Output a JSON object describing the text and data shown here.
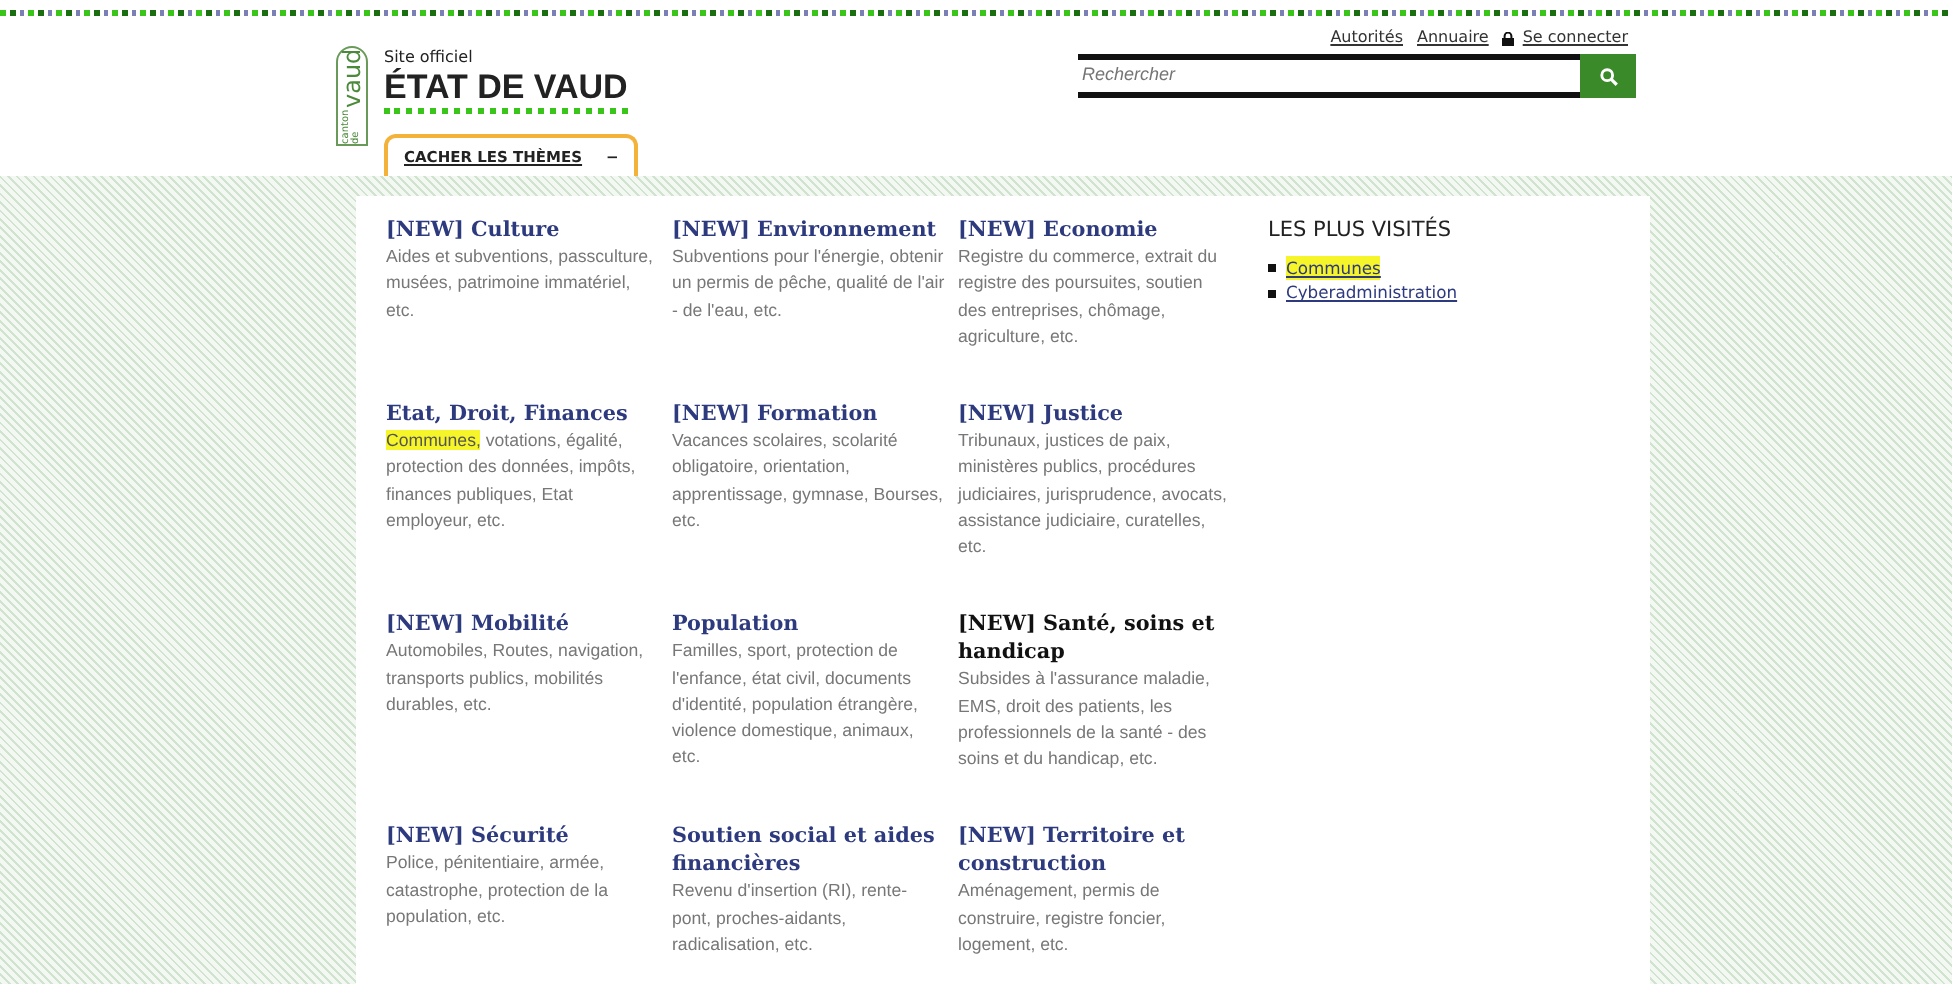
{
  "top_links": [
    {
      "label": "Autorités",
      "kind": "link"
    },
    {
      "label": "Annuaire",
      "kind": "link"
    },
    {
      "label": "Se connecter",
      "kind": "login"
    }
  ],
  "brand": {
    "logo_text": "vaud",
    "logo_small": "canton de",
    "kicker": "Site officiel",
    "title": "ÉTAT DE VAUD"
  },
  "search": {
    "placeholder": "Rechercher"
  },
  "themes_toggle": {
    "label": "CACHER LES THÈMES",
    "symbol": "−"
  },
  "themes": [
    {
      "title": "[NEW] Culture",
      "hovered": false,
      "description": [
        {
          "text": "Aides et subventions, passculture, musées, patrimoine immatériel, etc.",
          "highlighted": false
        }
      ]
    },
    {
      "title": "[NEW] Environnement",
      "hovered": false,
      "description": [
        {
          "text": "Subventions pour l'énergie, obtenir un permis de pêche, qualité de l'air - de l'eau, etc.",
          "highlighted": false
        }
      ]
    },
    {
      "title": "[NEW] Economie",
      "hovered": false,
      "description": [
        {
          "text": "Registre du commerce, extrait du registre des poursuites, soutien des entreprises, chômage, agriculture, etc.",
          "highlighted": false
        }
      ]
    },
    {
      "title": "Etat, Droit, Finances",
      "hovered": false,
      "description": [
        {
          "text": "Communes,",
          "highlighted": true
        },
        {
          "text": " votations, égalité, protection des données, impôts, finances publiques, Etat employeur, etc.",
          "highlighted": false
        }
      ]
    },
    {
      "title": "[NEW] Formation",
      "hovered": false,
      "description": [
        {
          "text": "Vacances scolaires, scolarité obligatoire, orientation, apprentissage, gymnase, Bourses, etc.",
          "highlighted": false
        }
      ]
    },
    {
      "title": "[NEW] Justice",
      "hovered": false,
      "description": [
        {
          "text": "Tribunaux, justices de paix, ministères publics, procédures judiciaires, jurisprudence, avocats, assistance judiciaire, curatelles, etc.",
          "highlighted": false
        }
      ]
    },
    {
      "title": "[NEW] Mobilité",
      "hovered": false,
      "description": [
        {
          "text": "Automobiles, Routes, navigation, transports publics, mobilités durables, etc.",
          "highlighted": false
        }
      ]
    },
    {
      "title": "Population",
      "hovered": false,
      "description": [
        {
          "text": "Familles, sport, protection de l'enfance, état civil, documents d'identité, population étrangère, violence domestique, animaux, etc.",
          "highlighted": false
        }
      ]
    },
    {
      "title": "[NEW] Santé, soins et handicap",
      "hovered": true,
      "description": [
        {
          "text": "Subsides à l'assurance maladie, EMS, droit des patients, les professionnels de la santé - des soins et du handicap, etc.",
          "highlighted": false
        }
      ]
    },
    {
      "title": "[NEW] Sécurité",
      "hovered": false,
      "description": [
        {
          "text": "Police, pénitentiaire, armée, catastrophe, protection de la population, etc.",
          "highlighted": false
        }
      ]
    },
    {
      "title": "Soutien social et aides financières",
      "hovered": false,
      "description": [
        {
          "text": "Revenu d'insertion (RI), rente-pont, proches-aidants, radicalisation, etc.",
          "highlighted": false
        }
      ]
    },
    {
      "title": "[NEW] Territoire et construction",
      "hovered": false,
      "description": [
        {
          "text": "Aménagement, permis de construire, registre foncier, logement, etc.",
          "highlighted": false
        }
      ]
    }
  ],
  "most_visited": {
    "title": "LES PLUS VISITÉS",
    "items": [
      {
        "label": "Communes",
        "highlighted": true
      },
      {
        "label": "Cyberadministration",
        "highlighted": false
      }
    ]
  }
}
